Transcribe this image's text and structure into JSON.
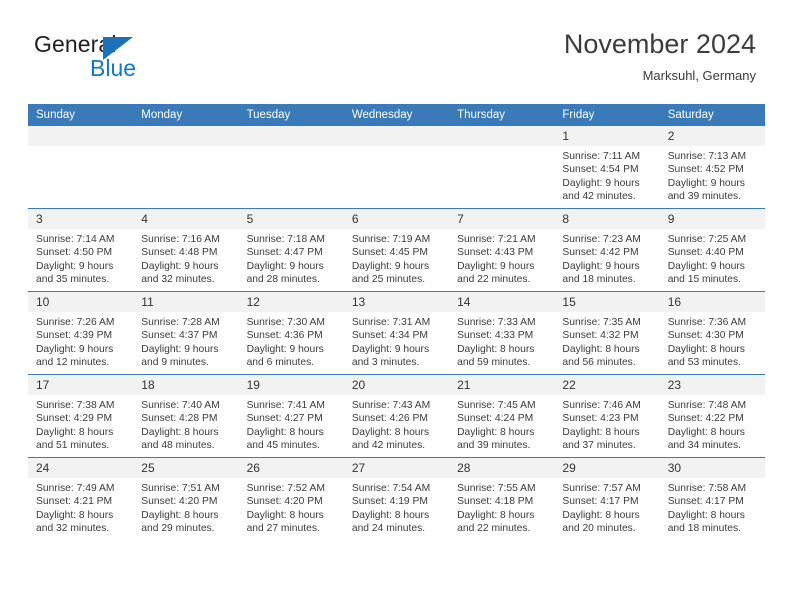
{
  "brand": {
    "word1": "General",
    "word2": "Blue",
    "accent_color": "#1d71b8",
    "blue_text_color": "#1279c4"
  },
  "header": {
    "title": "November 2024",
    "location": "Marksuhl, Germany"
  },
  "calendar": {
    "header_bg": "#3a7ab8",
    "daynum_bg": "#f2f2f2",
    "weekday_names": [
      "Sunday",
      "Monday",
      "Tuesday",
      "Wednesday",
      "Thursday",
      "Friday",
      "Saturday"
    ],
    "weeks": [
      [
        {
          "day": "",
          "sunrise": "",
          "sunset": "",
          "daylight": "",
          "daylight2": ""
        },
        {
          "day": "",
          "sunrise": "",
          "sunset": "",
          "daylight": "",
          "daylight2": ""
        },
        {
          "day": "",
          "sunrise": "",
          "sunset": "",
          "daylight": "",
          "daylight2": ""
        },
        {
          "day": "",
          "sunrise": "",
          "sunset": "",
          "daylight": "",
          "daylight2": ""
        },
        {
          "day": "",
          "sunrise": "",
          "sunset": "",
          "daylight": "",
          "daylight2": ""
        },
        {
          "day": "1",
          "sunrise": "Sunrise: 7:11 AM",
          "sunset": "Sunset: 4:54 PM",
          "daylight": "Daylight: 9 hours",
          "daylight2": "and 42 minutes."
        },
        {
          "day": "2",
          "sunrise": "Sunrise: 7:13 AM",
          "sunset": "Sunset: 4:52 PM",
          "daylight": "Daylight: 9 hours",
          "daylight2": "and 39 minutes."
        }
      ],
      [
        {
          "day": "3",
          "sunrise": "Sunrise: 7:14 AM",
          "sunset": "Sunset: 4:50 PM",
          "daylight": "Daylight: 9 hours",
          "daylight2": "and 35 minutes."
        },
        {
          "day": "4",
          "sunrise": "Sunrise: 7:16 AM",
          "sunset": "Sunset: 4:48 PM",
          "daylight": "Daylight: 9 hours",
          "daylight2": "and 32 minutes."
        },
        {
          "day": "5",
          "sunrise": "Sunrise: 7:18 AM",
          "sunset": "Sunset: 4:47 PM",
          "daylight": "Daylight: 9 hours",
          "daylight2": "and 28 minutes."
        },
        {
          "day": "6",
          "sunrise": "Sunrise: 7:19 AM",
          "sunset": "Sunset: 4:45 PM",
          "daylight": "Daylight: 9 hours",
          "daylight2": "and 25 minutes."
        },
        {
          "day": "7",
          "sunrise": "Sunrise: 7:21 AM",
          "sunset": "Sunset: 4:43 PM",
          "daylight": "Daylight: 9 hours",
          "daylight2": "and 22 minutes."
        },
        {
          "day": "8",
          "sunrise": "Sunrise: 7:23 AM",
          "sunset": "Sunset: 4:42 PM",
          "daylight": "Daylight: 9 hours",
          "daylight2": "and 18 minutes."
        },
        {
          "day": "9",
          "sunrise": "Sunrise: 7:25 AM",
          "sunset": "Sunset: 4:40 PM",
          "daylight": "Daylight: 9 hours",
          "daylight2": "and 15 minutes."
        }
      ],
      [
        {
          "day": "10",
          "sunrise": "Sunrise: 7:26 AM",
          "sunset": "Sunset: 4:39 PM",
          "daylight": "Daylight: 9 hours",
          "daylight2": "and 12 minutes."
        },
        {
          "day": "11",
          "sunrise": "Sunrise: 7:28 AM",
          "sunset": "Sunset: 4:37 PM",
          "daylight": "Daylight: 9 hours",
          "daylight2": "and 9 minutes."
        },
        {
          "day": "12",
          "sunrise": "Sunrise: 7:30 AM",
          "sunset": "Sunset: 4:36 PM",
          "daylight": "Daylight: 9 hours",
          "daylight2": "and 6 minutes."
        },
        {
          "day": "13",
          "sunrise": "Sunrise: 7:31 AM",
          "sunset": "Sunset: 4:34 PM",
          "daylight": "Daylight: 9 hours",
          "daylight2": "and 3 minutes."
        },
        {
          "day": "14",
          "sunrise": "Sunrise: 7:33 AM",
          "sunset": "Sunset: 4:33 PM",
          "daylight": "Daylight: 8 hours",
          "daylight2": "and 59 minutes."
        },
        {
          "day": "15",
          "sunrise": "Sunrise: 7:35 AM",
          "sunset": "Sunset: 4:32 PM",
          "daylight": "Daylight: 8 hours",
          "daylight2": "and 56 minutes."
        },
        {
          "day": "16",
          "sunrise": "Sunrise: 7:36 AM",
          "sunset": "Sunset: 4:30 PM",
          "daylight": "Daylight: 8 hours",
          "daylight2": "and 53 minutes."
        }
      ],
      [
        {
          "day": "17",
          "sunrise": "Sunrise: 7:38 AM",
          "sunset": "Sunset: 4:29 PM",
          "daylight": "Daylight: 8 hours",
          "daylight2": "and 51 minutes."
        },
        {
          "day": "18",
          "sunrise": "Sunrise: 7:40 AM",
          "sunset": "Sunset: 4:28 PM",
          "daylight": "Daylight: 8 hours",
          "daylight2": "and 48 minutes."
        },
        {
          "day": "19",
          "sunrise": "Sunrise: 7:41 AM",
          "sunset": "Sunset: 4:27 PM",
          "daylight": "Daylight: 8 hours",
          "daylight2": "and 45 minutes."
        },
        {
          "day": "20",
          "sunrise": "Sunrise: 7:43 AM",
          "sunset": "Sunset: 4:26 PM",
          "daylight": "Daylight: 8 hours",
          "daylight2": "and 42 minutes."
        },
        {
          "day": "21",
          "sunrise": "Sunrise: 7:45 AM",
          "sunset": "Sunset: 4:24 PM",
          "daylight": "Daylight: 8 hours",
          "daylight2": "and 39 minutes."
        },
        {
          "day": "22",
          "sunrise": "Sunrise: 7:46 AM",
          "sunset": "Sunset: 4:23 PM",
          "daylight": "Daylight: 8 hours",
          "daylight2": "and 37 minutes."
        },
        {
          "day": "23",
          "sunrise": "Sunrise: 7:48 AM",
          "sunset": "Sunset: 4:22 PM",
          "daylight": "Daylight: 8 hours",
          "daylight2": "and 34 minutes."
        }
      ],
      [
        {
          "day": "24",
          "sunrise": "Sunrise: 7:49 AM",
          "sunset": "Sunset: 4:21 PM",
          "daylight": "Daylight: 8 hours",
          "daylight2": "and 32 minutes."
        },
        {
          "day": "25",
          "sunrise": "Sunrise: 7:51 AM",
          "sunset": "Sunset: 4:20 PM",
          "daylight": "Daylight: 8 hours",
          "daylight2": "and 29 minutes."
        },
        {
          "day": "26",
          "sunrise": "Sunrise: 7:52 AM",
          "sunset": "Sunset: 4:20 PM",
          "daylight": "Daylight: 8 hours",
          "daylight2": "and 27 minutes."
        },
        {
          "day": "27",
          "sunrise": "Sunrise: 7:54 AM",
          "sunset": "Sunset: 4:19 PM",
          "daylight": "Daylight: 8 hours",
          "daylight2": "and 24 minutes."
        },
        {
          "day": "28",
          "sunrise": "Sunrise: 7:55 AM",
          "sunset": "Sunset: 4:18 PM",
          "daylight": "Daylight: 8 hours",
          "daylight2": "and 22 minutes."
        },
        {
          "day": "29",
          "sunrise": "Sunrise: 7:57 AM",
          "sunset": "Sunset: 4:17 PM",
          "daylight": "Daylight: 8 hours",
          "daylight2": "and 20 minutes."
        },
        {
          "day": "30",
          "sunrise": "Sunrise: 7:58 AM",
          "sunset": "Sunset: 4:17 PM",
          "daylight": "Daylight: 8 hours",
          "daylight2": "and 18 minutes."
        }
      ]
    ]
  }
}
